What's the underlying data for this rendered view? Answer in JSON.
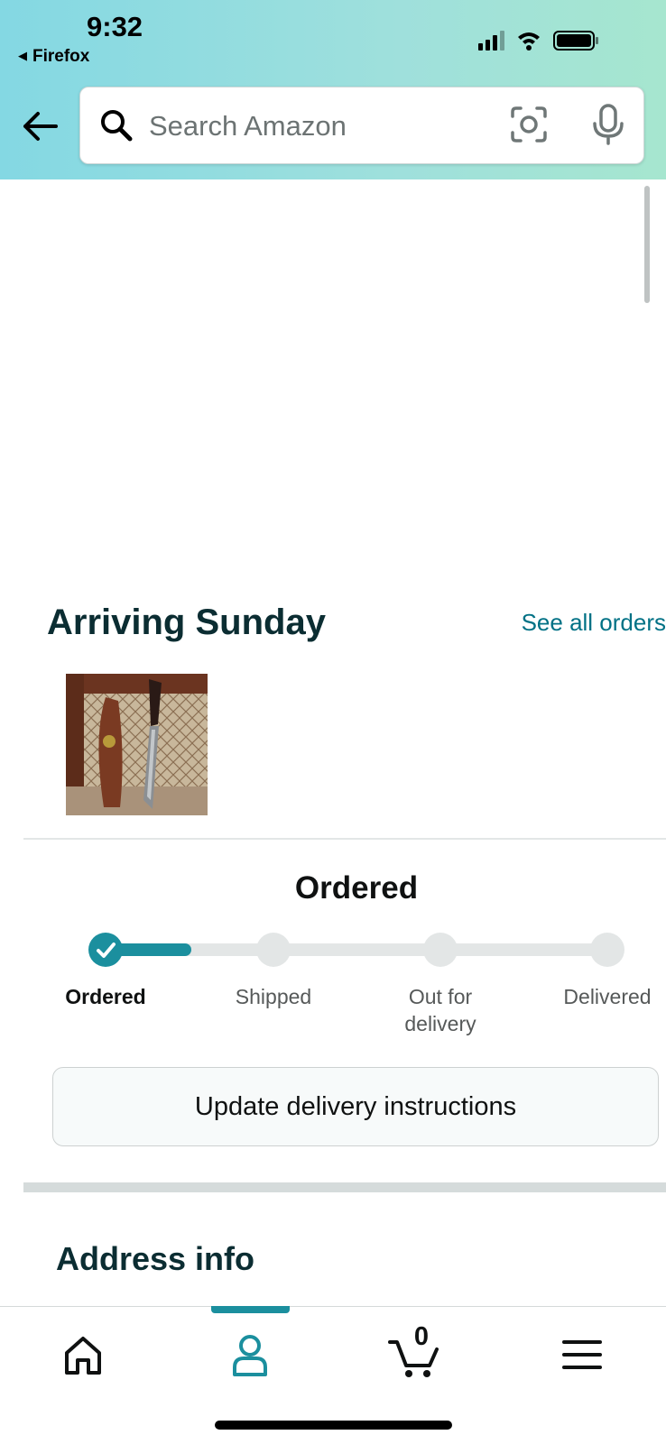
{
  "status_bar": {
    "time": "9:32",
    "back_app": "Firefox"
  },
  "search": {
    "placeholder": "Search Amazon"
  },
  "delivery": {
    "heading": "Arriving Sunday",
    "see_all_label": "See all orders",
    "status_title": "Ordered",
    "progress_fraction": 0.17,
    "steps": [
      {
        "label": "Ordered",
        "done": true
      },
      {
        "label": "Shipped",
        "done": false
      },
      {
        "label": "Out for delivery",
        "done": false
      },
      {
        "label": "Delivered",
        "done": false
      }
    ],
    "update_button_label": "Update delivery instructions"
  },
  "address": {
    "heading": "Address info"
  },
  "bottom_nav": {
    "items": [
      "home-icon",
      "account-icon",
      "cart-icon",
      "menu-icon"
    ],
    "active": "account-icon",
    "cart_count": "0"
  },
  "colors": {
    "accent": "#1b8f9e",
    "link": "#007185",
    "heading": "#0b2d32"
  }
}
